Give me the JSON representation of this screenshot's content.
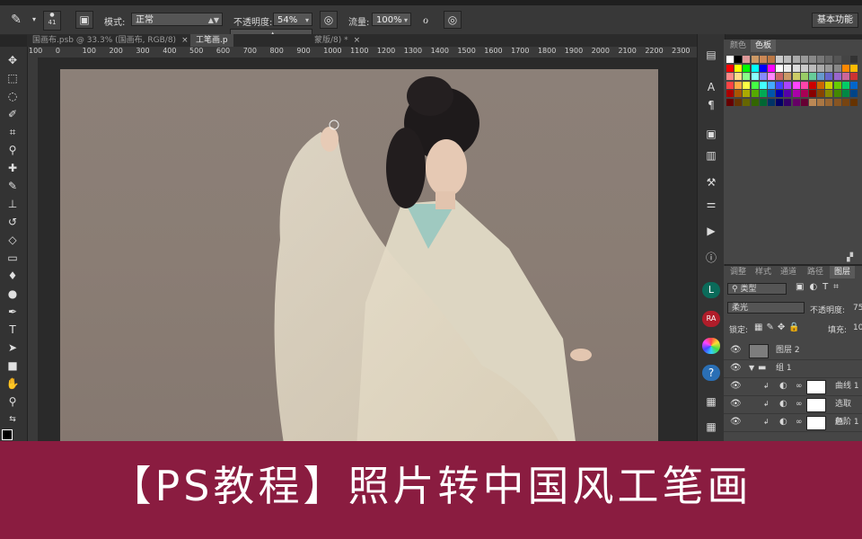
{
  "options_bar": {
    "brush_size": "41",
    "mode_label": "模式:",
    "mode_value": "正常",
    "opacity_label": "不透明度:",
    "opacity_value": "54%",
    "flow_label": "流量:",
    "flow_value": "100%",
    "workspace": "基本功能"
  },
  "tabs": [
    {
      "label": "国画布.psb @ 33.3% (国画布, RGB/8)",
      "close": "×"
    },
    {
      "label": "工笔画.p",
      "close": ""
    },
    {
      "label": "蒙版/8) *",
      "close": "×"
    }
  ],
  "ruler_ticks": [
    "100",
    "0",
    "100",
    "200",
    "300",
    "400",
    "500",
    "600",
    "700",
    "800",
    "900",
    "1000",
    "1100",
    "1200",
    "1300",
    "1400",
    "1500",
    "1600",
    "1700",
    "1800",
    "1900",
    "2000",
    "2100",
    "2200",
    "2300"
  ],
  "panels": {
    "swatch_tabs": [
      "颜色",
      "色板"
    ],
    "layer_tabs": [
      "调整",
      "样式",
      "通道",
      "路径",
      "图层"
    ],
    "filter_kind": "类型",
    "blend_mode": "柔光",
    "opacity_label": "不透明度:",
    "opacity_value": "75",
    "lock_label": "锁定:",
    "fill_label": "填充:",
    "fill_value": "10",
    "layers": [
      {
        "name": "图层 2"
      },
      {
        "name": "组 1"
      },
      {
        "name": "曲线 1"
      },
      {
        "name": "选取颜..."
      },
      {
        "name": "色阶 1"
      }
    ]
  },
  "icon_col_badges": {
    "ra": "RA",
    "l": "L"
  },
  "banner_text": "【PS教程】照片转中国风工笔画",
  "colors": {
    "banner": "#8a1c40",
    "canvas": "#8a7d74"
  }
}
